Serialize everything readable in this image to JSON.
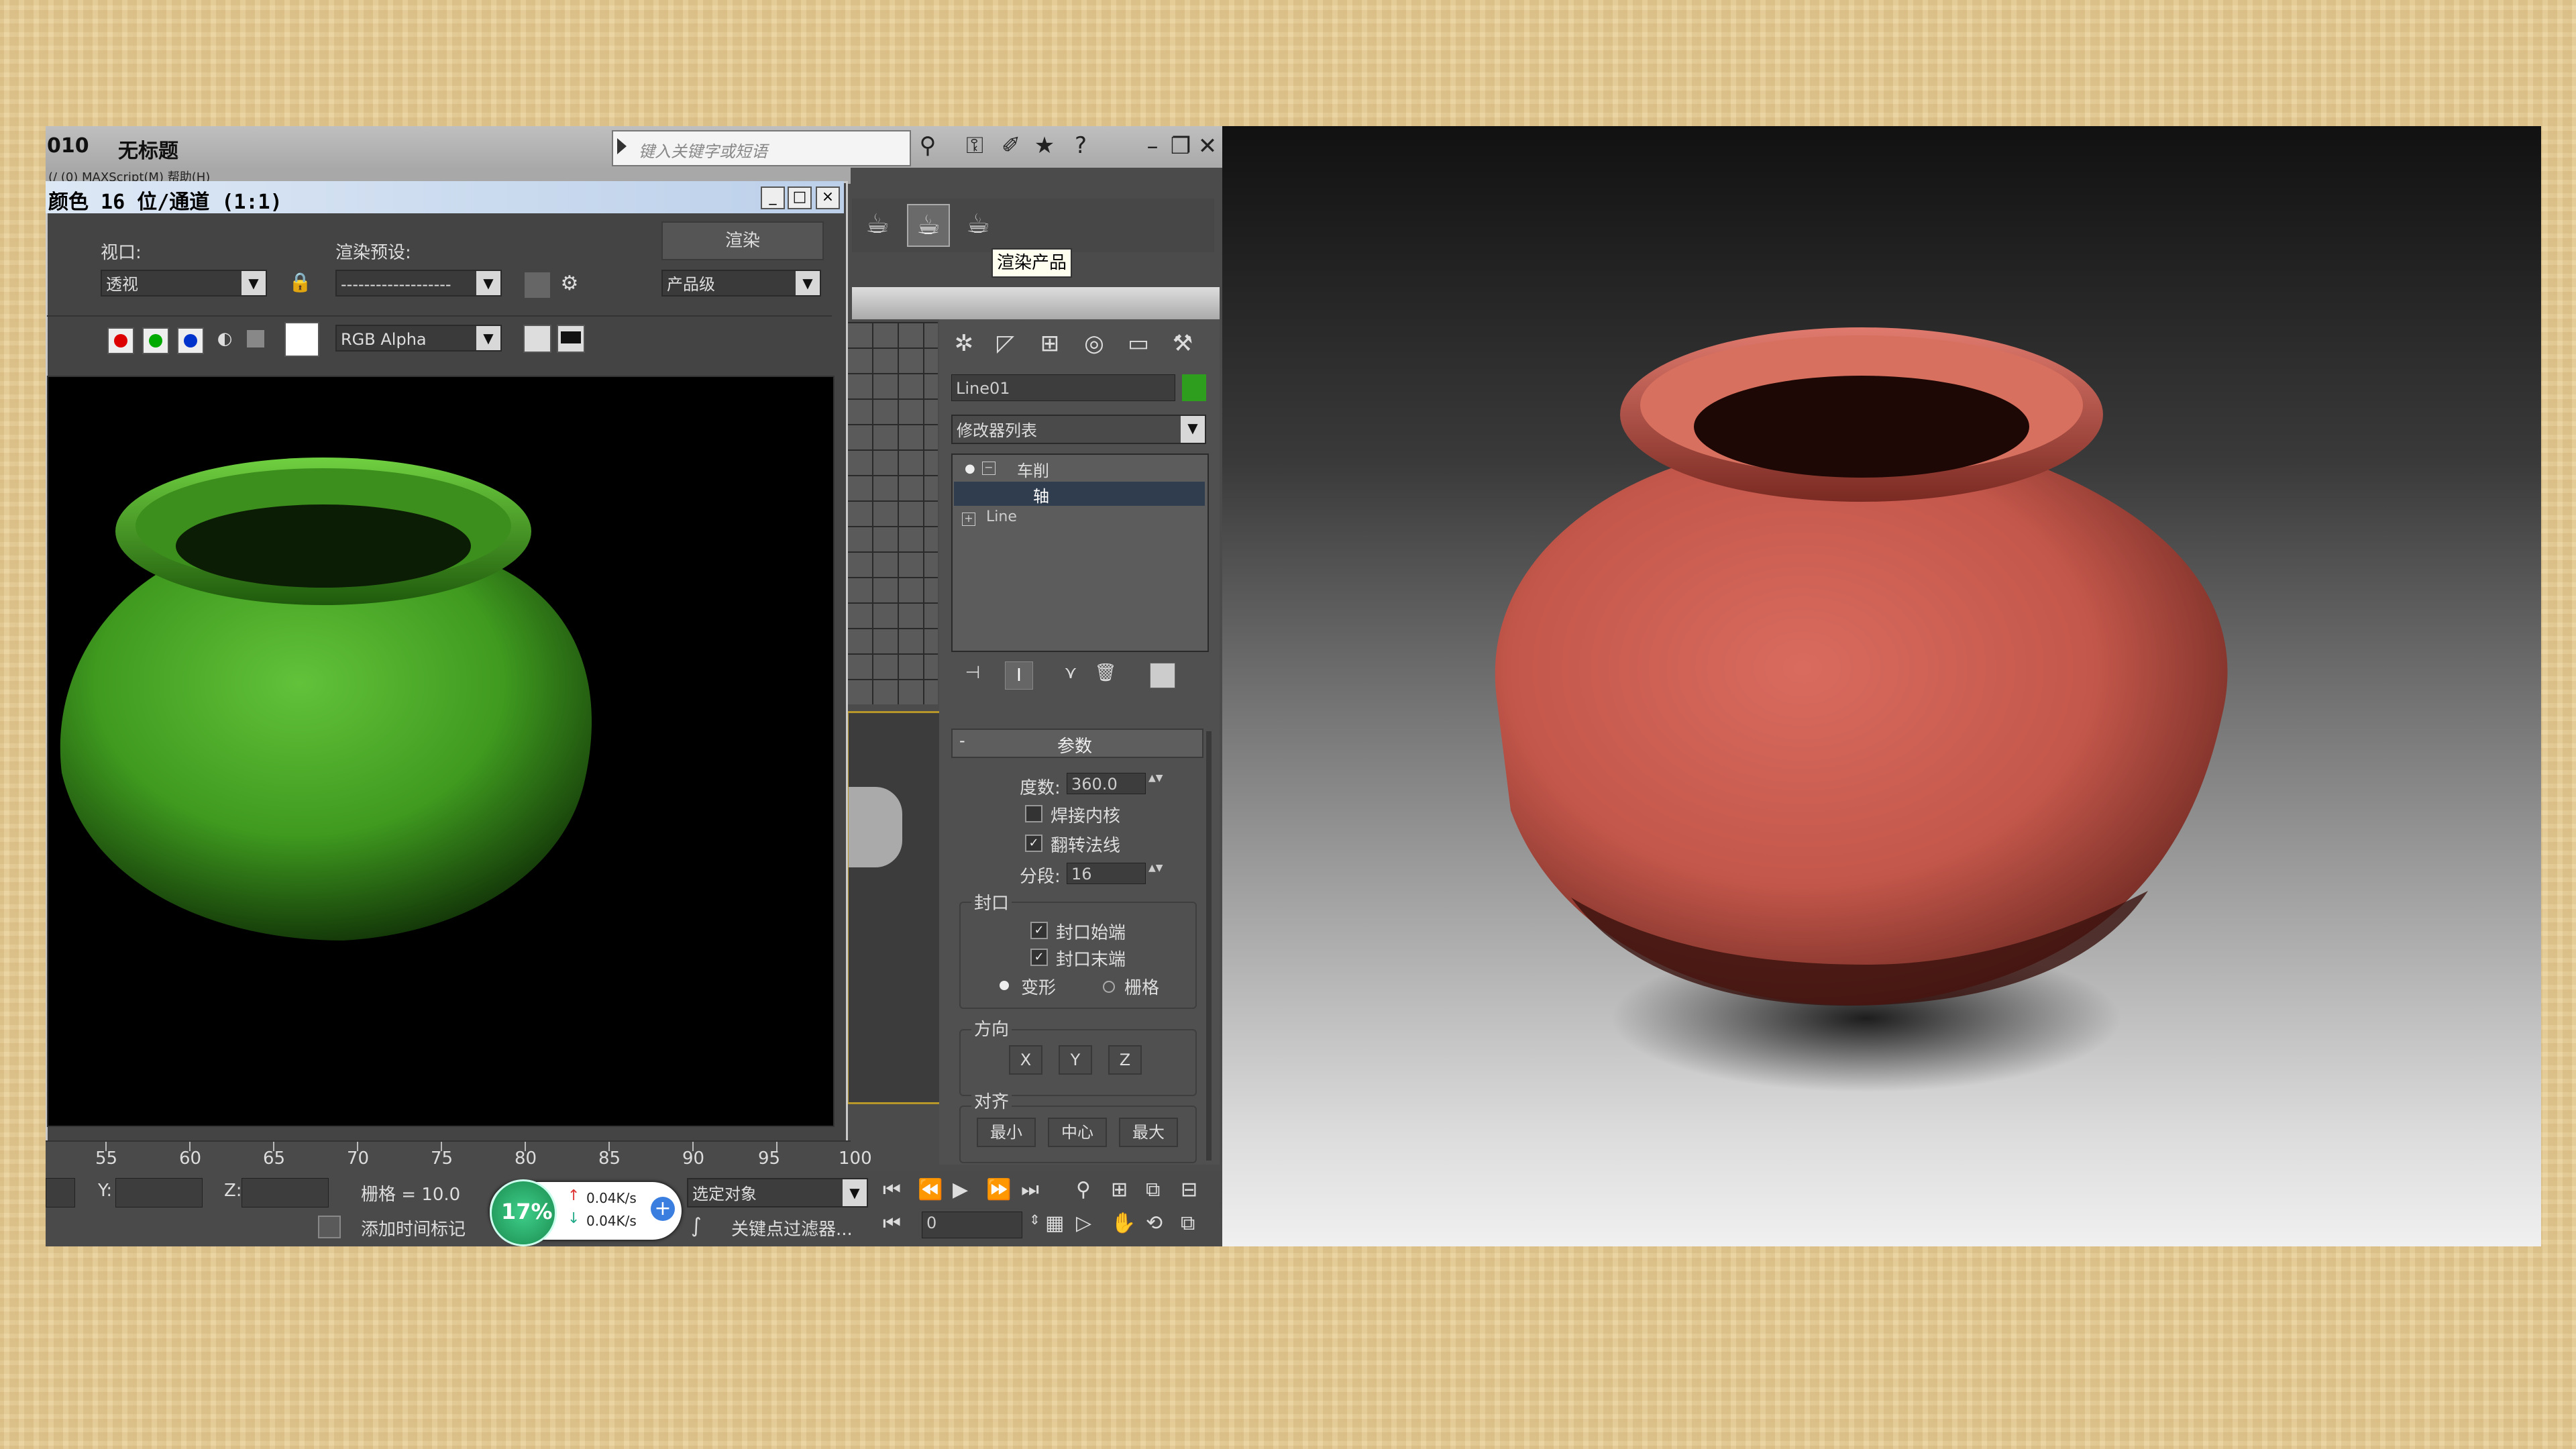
{
  "app": {
    "version_fragment": "010",
    "doc_title": "无标题",
    "menu_fragment": "(/ (0)        MAXScript(M)      帮助(H)",
    "search_placeholder": "键入关键字或短语"
  },
  "tooltip": "渲染产品",
  "render_frame": {
    "title": "颜色 16 位/通道 (1:1)",
    "viewport_label": "视口:",
    "viewport_value": "透视",
    "preset_label": "渲染预设:",
    "preset_value": "-------------------",
    "render_button": "渲染",
    "quality_value": "产品级",
    "channel_value": "RGB Alpha"
  },
  "command_panel": {
    "object_name": "Line01",
    "object_color": "#2e9e1e",
    "modifier_list": "修改器列表",
    "stack": [
      "车削",
      "轴",
      "Line"
    ],
    "rollout_title": "参数",
    "degrees_label": "度数:",
    "degrees_value": "360.0",
    "weld_core": "焊接内核",
    "flip_normals": "翻转法线",
    "segments_label": "分段:",
    "segments_value": "16",
    "cap_group": "封口",
    "cap_start": "封口始端",
    "cap_end": "封口末端",
    "morph": "变形",
    "grid": "栅格",
    "direction_group": "方向",
    "dir_x": "X",
    "dir_y": "Y",
    "dir_z": "Z",
    "align_group": "对齐",
    "align_min": "最小",
    "align_center": "中心",
    "align_max": "最大"
  },
  "ruler": [
    "55",
    "60",
    "65",
    "70",
    "75",
    "80",
    "85",
    "90",
    "95",
    "100"
  ],
  "status": {
    "y_label": "Y:",
    "z_label": "Z:",
    "grid": "栅格 = 10.0",
    "progress": "17%",
    "up_speed": "0.04K/s",
    "down_speed": "0.04K/s",
    "selection": "选定对象",
    "add_time_tag": "添加时间标记",
    "key_filters": "关键点过滤器...",
    "frame_value": "0"
  },
  "colors": {
    "vase_left": "#3f9a1f",
    "vase_right": "#c4574b"
  }
}
